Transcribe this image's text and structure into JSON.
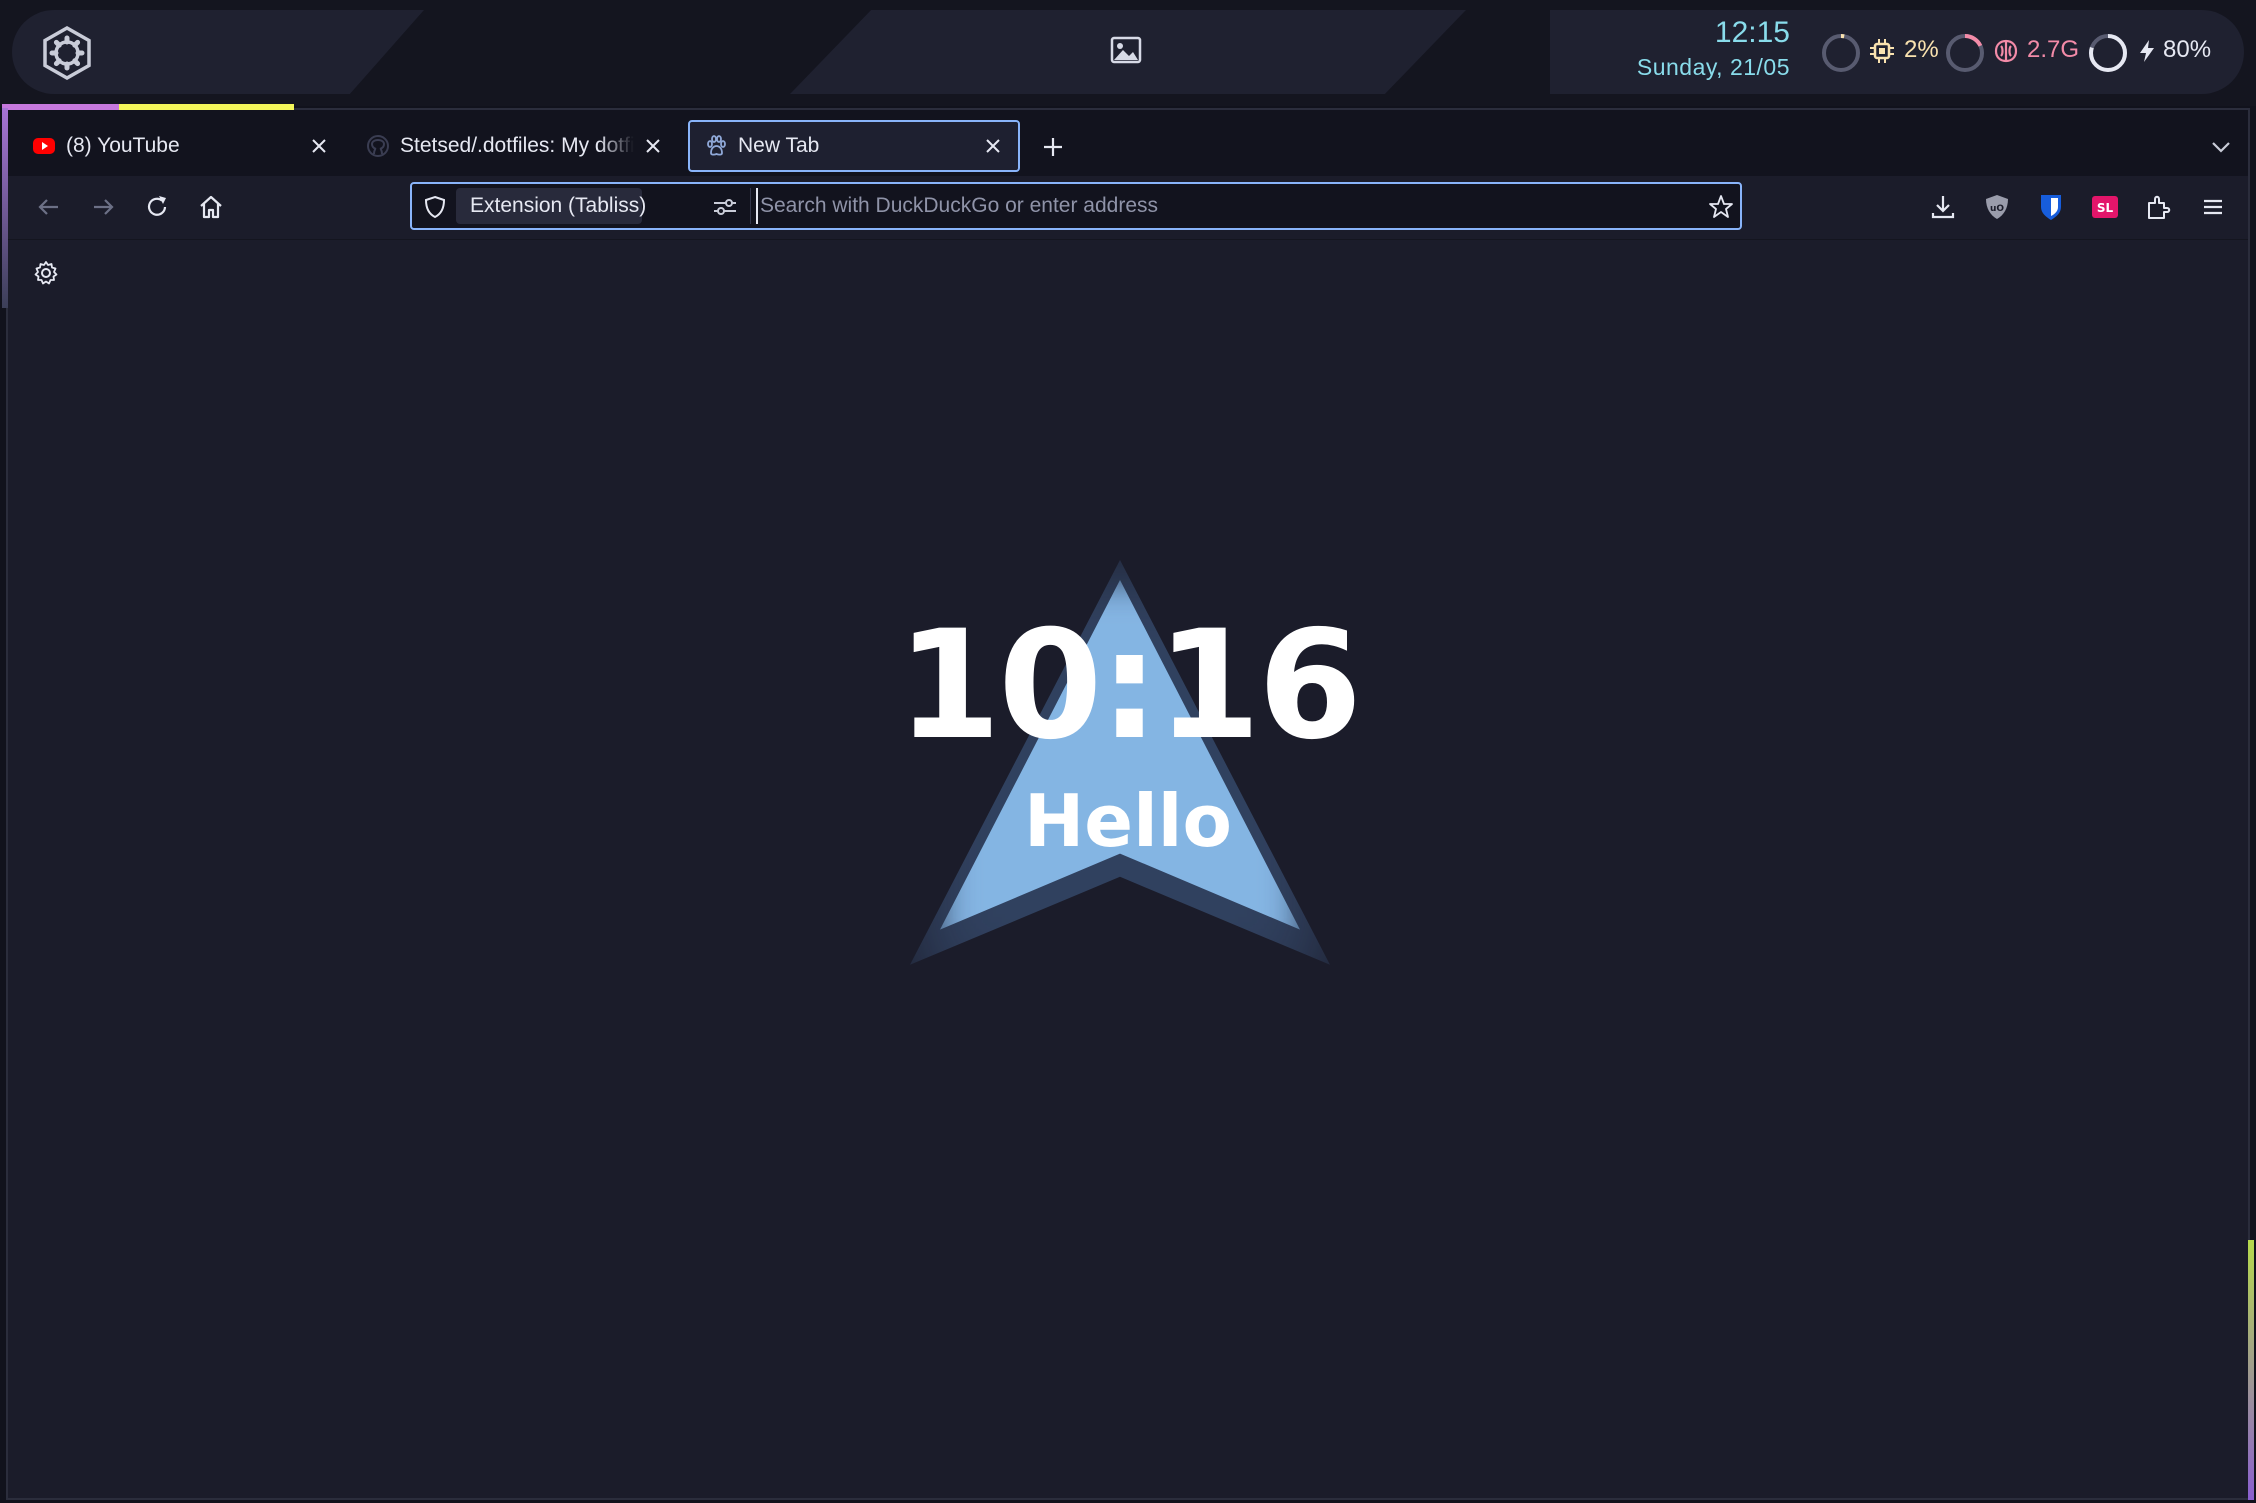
{
  "topbar": {
    "launcher_icon": "gear-hexagon-icon",
    "wallpaper_icon": "image-icon",
    "clock": {
      "time": "12:15",
      "date": "Sunday, 21/05"
    },
    "cpu": {
      "value": "2%",
      "icon": "cpu-icon",
      "fraction": 0.02
    },
    "memory": {
      "value": "2.7G",
      "icon": "memory-icon",
      "fraction": 0.18
    },
    "battery": {
      "value": "80%",
      "icon": "bolt-icon",
      "fraction": 0.8
    },
    "colors": {
      "clock": "#89dceb",
      "cpu": "#f9e2af",
      "memory": "#f38ba8",
      "battery": "#e6e8f2",
      "ring_track": "#585b70"
    }
  },
  "browser": {
    "tabs": [
      {
        "title": "(8) YouTube",
        "favicon": "youtube-icon",
        "active": false
      },
      {
        "title": "Stetsed/.dotfiles: My dotfiles",
        "favicon": "github-icon",
        "active": false
      },
      {
        "title": "New Tab",
        "favicon": "tabliss-icon",
        "active": true
      }
    ],
    "navbar": {
      "identity_label": "Extension (Tabliss)",
      "search_placeholder": "Search with DuckDuckGo or enter address",
      "search_value": ""
    },
    "toolbar_icons": [
      "download-icon",
      "ublock-icon",
      "bitwarden-icon",
      "simplelogin-icon",
      "extensions-icon",
      "menu-icon"
    ],
    "accent": "#89b4fa"
  },
  "newtab": {
    "time": "10:16",
    "greeting": "Hello",
    "settings_icon": "gear-icon"
  }
}
